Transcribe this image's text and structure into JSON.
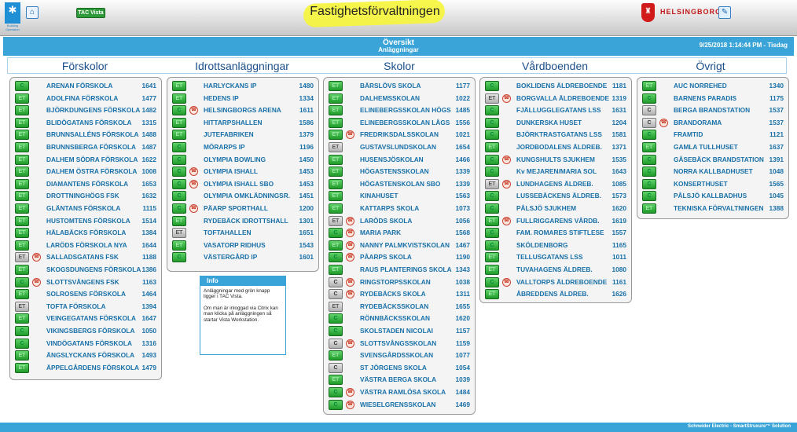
{
  "header": {
    "logo_text": "Building Operation",
    "tac_label": "TAC Vista",
    "title": "Fastighetsförvaltningen",
    "city": "HELSINGBORG"
  },
  "overview": {
    "title": "Översikt",
    "subtitle": "Anläggningar",
    "datetime": "9/25/2018 1:14:44 PM - Tisdag"
  },
  "categories": [
    "Förskolor",
    "Idrottsanläggningar",
    "Skolor",
    "Vårdboenden",
    "Övrigt"
  ],
  "colors": {
    "accent": "#3aa4d8",
    "link": "#1870a8",
    "button_green": "#2f9a3a",
    "button_gray": "#b0b0b0",
    "highlight": "#f6f53a"
  },
  "columns": [
    {
      "items": [
        {
          "b": "C",
          "n": "ARENAN FÖRSKOLA",
          "v": "1641"
        },
        {
          "b": "ET",
          "n": "ADOLFINA FÖRSKOLA",
          "v": "1477"
        },
        {
          "b": "ET",
          "n": "BJÖRKDUNGENS FÖRSKOLA",
          "v": "1482"
        },
        {
          "b": "ET",
          "n": "BLIDÖGATANS FÖRSKOLA",
          "v": "1315"
        },
        {
          "b": "ET",
          "n": "BRUNNSALLÉNS FÖRSKOLA",
          "v": "1488"
        },
        {
          "b": "ET",
          "n": "BRUNNSBERGA FÖRSKOLA",
          "v": "1487"
        },
        {
          "b": "ET",
          "n": "DALHEM SÖDRA FÖRSKOLA",
          "v": "1622"
        },
        {
          "b": "ET",
          "n": "DALHEM ÖSTRA FÖRSKOLA",
          "v": "1008"
        },
        {
          "b": "ET",
          "n": "DIAMANTENS FÖRSKOLA",
          "v": "1653"
        },
        {
          "b": "ET",
          "n": "DROTTNINGHÖGS FSK",
          "v": "1632"
        },
        {
          "b": "ET",
          "n": "GLÄNTANS FÖRSKOLA",
          "v": "1115"
        },
        {
          "b": "ET",
          "n": "HUSTOMTENS FÖRSKOLA",
          "v": "1514"
        },
        {
          "b": "ET",
          "n": "HÄLABÄCKS FÖRSKOLA",
          "v": "1384"
        },
        {
          "b": "ET",
          "n": "LARÖDS FÖRSKOLA NYA",
          "v": "1644"
        },
        {
          "b": "ETG",
          "n": "SALLADSGATANS FSK",
          "v": "1188",
          "a": true
        },
        {
          "b": "ET",
          "n": "SKOGSDUNGENS FÖRSKOLA",
          "v": "1386"
        },
        {
          "b": "C",
          "n": "SLOTTSVÅNGENS FSK",
          "v": "1163",
          "a": true
        },
        {
          "b": "ET",
          "n": "SOLROSENS FÖRSKOLA",
          "v": "1464"
        },
        {
          "b": "ETG",
          "n": "TOFTA FÖRSKOLA",
          "v": "1394"
        },
        {
          "b": "ET",
          "n": "VEINGEGATANS FÖRSKOLA",
          "v": "1647"
        },
        {
          "b": "C",
          "n": "VIKINGSBERGS FÖRSKOLA",
          "v": "1050"
        },
        {
          "b": "C",
          "n": "VINDÖGATANS FÖRSKOLA",
          "v": "1316"
        },
        {
          "b": "ET",
          "n": "ÄNGSLYCKANS FÖRSKOLA",
          "v": "1493"
        },
        {
          "b": "ET",
          "n": "ÄPPELGÅRDENS FÖRSKOLA",
          "v": "1479"
        }
      ]
    },
    {
      "items": [
        {
          "b": "ET",
          "n": "HARLYCKANS IP",
          "v": "1480"
        },
        {
          "b": "ET",
          "n": "HEDENS IP",
          "v": "1334"
        },
        {
          "b": "C",
          "n": "HELSINGBORGS ARENA",
          "v": "1611",
          "a": true
        },
        {
          "b": "ET",
          "n": "HITTARPSHALLEN",
          "v": "1586"
        },
        {
          "b": "ET",
          "n": "JUTEFABRIKEN",
          "v": "1379"
        },
        {
          "b": "C",
          "n": "MÖRARPS IP",
          "v": "1196"
        },
        {
          "b": "C",
          "n": "OLYMPIA BOWLING",
          "v": "1450"
        },
        {
          "b": "C",
          "n": "OLYMPIA ISHALL",
          "v": "1453",
          "a": true
        },
        {
          "b": "C",
          "n": "OLYMPIA ISHALL SBO",
          "v": "1453",
          "a": true
        },
        {
          "b": "C",
          "n": "OLYMPIA OMKLÄDNINGSR.",
          "v": "1451"
        },
        {
          "b": "C",
          "n": "PÄARP SPORTHALL",
          "v": "1200",
          "a": true
        },
        {
          "b": "ET",
          "n": "RYDEBÄCK IDROTTSHALL",
          "v": "1301"
        },
        {
          "b": "ETG",
          "n": "TOFTAHALLEN",
          "v": "1651"
        },
        {
          "b": "ET",
          "n": "VASATORP RIDHUS",
          "v": "1543"
        },
        {
          "b": "C",
          "n": "VÄSTERGÅRD IP",
          "v": "1601"
        }
      ]
    },
    {
      "items": [
        {
          "b": "ET",
          "n": "BÄRSLÖVS SKOLA",
          "v": "1177"
        },
        {
          "b": "ET",
          "n": "DALHEMSSKOLAN",
          "v": "1022"
        },
        {
          "b": "ET",
          "n": "ELINEBERGSSKOLAN HÖGS",
          "v": "1485"
        },
        {
          "b": "ET",
          "n": "ELINEBERGSSKOLAN LÅGS",
          "v": "1556"
        },
        {
          "b": "ET",
          "n": "FREDRIKSDALSSKOLAN",
          "v": "1021",
          "a": true
        },
        {
          "b": "ETG",
          "n": "GUSTAVSLUNDSKOLAN",
          "v": "1654"
        },
        {
          "b": "ET",
          "n": "HUSENSJÖSKOLAN",
          "v": "1466"
        },
        {
          "b": "ET",
          "n": "HÖGASTENSSKOLAN",
          "v": "1339"
        },
        {
          "b": "ET",
          "n": "HÖGASTENSKOLAN SBO",
          "v": "1339"
        },
        {
          "b": "ET",
          "n": "KINAHUSET",
          "v": "1563"
        },
        {
          "b": "ET",
          "n": "KATTARPS SKOLA",
          "v": "1073"
        },
        {
          "b": "ETG",
          "n": "LARÖDS SKOLA",
          "v": "1056",
          "a": true
        },
        {
          "b": "C",
          "n": "MARIA PARK",
          "v": "1568",
          "a": true
        },
        {
          "b": "ET",
          "n": "NANNY PALMKVISTSKOLAN",
          "v": "1467",
          "a": true
        },
        {
          "b": "C",
          "n": "PÅARPS SKOLA",
          "v": "1190",
          "a": true
        },
        {
          "b": "ET",
          "n": "RAUS PLANTERINGS SKOLA",
          "v": "1343"
        },
        {
          "b": "CG",
          "n": "RINGSTORPSSKOLAN",
          "v": "1038",
          "a": true
        },
        {
          "b": "CG",
          "n": "RYDEBÄCKS SKOLA",
          "v": "1311",
          "a": true
        },
        {
          "b": "ETG",
          "n": "RYDEBÄCKSSKOLAN",
          "v": "1655"
        },
        {
          "b": "C",
          "n": "RÖNNBÄCKSSKOLAN",
          "v": "1620"
        },
        {
          "b": "C",
          "n": "SKOLSTADEN NICOLAI",
          "v": "1157"
        },
        {
          "b": "CG",
          "n": "SLOTTSVÅNGSSKOLAN",
          "v": "1159",
          "a": true
        },
        {
          "b": "ET",
          "n": "SVENSGÅRDSSKOLAN",
          "v": "1077"
        },
        {
          "b": "CG",
          "n": "ST JÖRGENS SKOLA",
          "v": "1054"
        },
        {
          "b": "ET",
          "n": "VÄSTRA BERGA SKOLA",
          "v": "1039"
        },
        {
          "b": "C",
          "n": "VÄSTRA RAMLÖSA SKOLA",
          "v": "1484",
          "a": true
        },
        {
          "b": "C",
          "n": "WIESELGRENSSKOLAN",
          "v": "1469",
          "a": true
        }
      ]
    },
    {
      "items": [
        {
          "b": "C",
          "n": "BOKLIDENS ÄLDREBOENDE",
          "v": "1181"
        },
        {
          "b": "ETG",
          "n": "BORGVALLA ÄLDREBOENDE",
          "v": "1319",
          "a": true
        },
        {
          "b": "C",
          "n": "FJÄLLUGGLEGATANS LSS",
          "v": "1631"
        },
        {
          "b": "C",
          "n": "DUNKERSKA HUSET",
          "v": "1204"
        },
        {
          "b": "C",
          "n": "BJÖRKTRASTGATANS LSS",
          "v": "1581"
        },
        {
          "b": "ET",
          "n": "JORDBODALENS ÄLDREB.",
          "v": "1371"
        },
        {
          "b": "C",
          "n": "KUNGSHULTS SJUKHEM",
          "v": "1535",
          "a": true
        },
        {
          "b": "C",
          "n": "Kv MEJAREN/MARIA SOL",
          "v": "1643"
        },
        {
          "b": "ETG",
          "n": "LUNDHAGENS ÄLDREB.",
          "v": "1085",
          "a": true
        },
        {
          "b": "C",
          "n": "LUSSEBÄCKENS ÄLDREB.",
          "v": "1573"
        },
        {
          "b": "C",
          "n": "PÅLSJÖ SJUKHEM",
          "v": "1620"
        },
        {
          "b": "ET",
          "n": "FULLRIGGARENS VÅRDB.",
          "v": "1619",
          "a": true
        },
        {
          "b": "C",
          "n": "FAM. ROMARES STIFTLESE",
          "v": "1557"
        },
        {
          "b": "C",
          "n": "SKÖLDENBORG",
          "v": "1165"
        },
        {
          "b": "ET",
          "n": "TELLUSGATANS LSS",
          "v": "1011"
        },
        {
          "b": "ET",
          "n": "TUVAHAGENS ÄLDREB.",
          "v": "1080"
        },
        {
          "b": "C",
          "n": "VALLTORPS ÄLDREBOENDE",
          "v": "1161",
          "a": true
        },
        {
          "b": "ET",
          "n": "ÅBREDDENS ÄLDREB.",
          "v": "1626"
        }
      ]
    },
    {
      "items": [
        {
          "b": "ET",
          "n": "AUC NORREHED",
          "v": "1340"
        },
        {
          "b": "C",
          "n": "BARNENS PARADIS",
          "v": "1175"
        },
        {
          "b": "CG",
          "n": "BERGA BRANDSTATION",
          "v": "1537"
        },
        {
          "b": "CG",
          "n": "BRANDORAMA",
          "v": "1537",
          "a": true
        },
        {
          "b": "C",
          "n": "FRAMTID",
          "v": "1121"
        },
        {
          "b": "ET",
          "n": "GAMLA TULLHUSET",
          "v": "1637"
        },
        {
          "b": "C",
          "n": "GÅSEBÄCK BRANDSTATION",
          "v": "1391"
        },
        {
          "b": "C",
          "n": "NORRA KALLBADHUSET",
          "v": "1048"
        },
        {
          "b": "C",
          "n": "KONSERTHUSET",
          "v": "1565"
        },
        {
          "b": "C",
          "n": "PÅLSJÖ KALLBADHUS",
          "v": "1045"
        },
        {
          "b": "ET",
          "n": "TEKNISKA FÖRVALTNINGEN",
          "v": "1388"
        }
      ]
    }
  ],
  "button_labels": {
    "C": "C",
    "ET": "ET"
  },
  "info": {
    "title": "Info",
    "p1": "Anläggningar med grön knapp ligger i TAC Vista.",
    "p2": "Om man är inloggad via Citrix kan man klicka på anläggningen så startar Vista Workstation."
  },
  "footer": "Schneider Electric - SmartStruxure™ Solution"
}
